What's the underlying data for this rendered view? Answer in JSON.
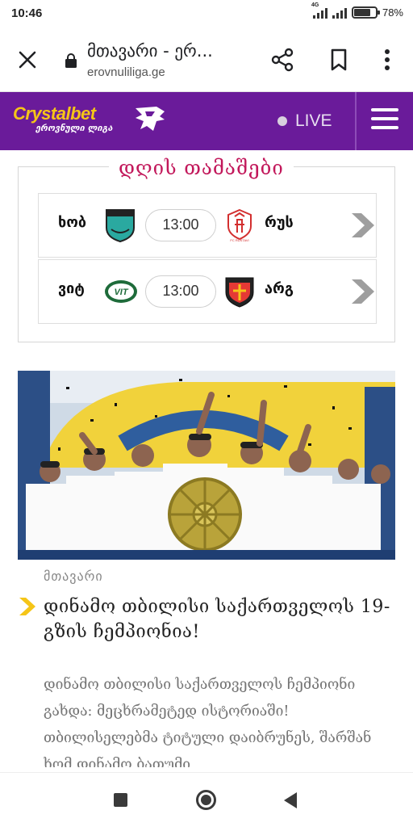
{
  "status_bar": {
    "time": "10:46",
    "network_label": "4G",
    "battery_text": "78%",
    "battery_level": 0.78
  },
  "browser": {
    "page_title": "მთავარი - ერ...",
    "domain": "erovnuliliga.ge",
    "icons": [
      "close-icon",
      "lock-icon",
      "share-icon",
      "bookmark-icon",
      "more-vert-icon"
    ]
  },
  "site_header": {
    "logo_text": "Crystalbet",
    "logo_subtitle": "ეროვნული ლიგა",
    "live_label": "LIVE",
    "brand_color": "#6a1b9a",
    "logo_color": "#f5c518"
  },
  "games": {
    "title": "დღის თამაშები",
    "matches": [
      {
        "home": "ხობ",
        "time": "13:00",
        "away": "რუს",
        "away_crest_text": "FC RUSTAVI"
      },
      {
        "home": "ვიტ",
        "time": "13:00",
        "away": "არგ",
        "home_crest_text": "VIT"
      }
    ]
  },
  "news": {
    "category": "მთავარი",
    "title": "დინამო თბილისი საქართველოს 19-გზის ჩემპიონია!",
    "excerpt": "დინამო თბილისი საქართველოს ჩემპიონი გახდა: მეცხრამეტედ ისტორიაში! თბილისელებმა ტიტული დაიბრუნეს, შარშან ხომ დინამო ბათუმი",
    "accent_color": "#f5c518"
  },
  "nav_bar": {
    "icons": [
      "recent-apps-icon",
      "home-icon",
      "back-icon"
    ]
  }
}
